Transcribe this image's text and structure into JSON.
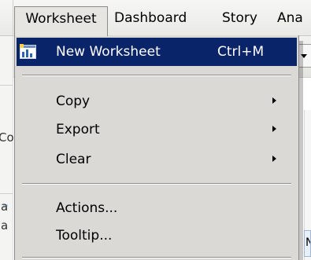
{
  "menubar": {
    "items": [
      {
        "label": "Worksheet"
      },
      {
        "label": "Dashboard"
      },
      {
        "label": "Story"
      },
      {
        "label": "Ana"
      }
    ]
  },
  "dropdown": {
    "items": [
      {
        "label": "New Worksheet",
        "shortcut": "Ctrl+M",
        "icon": "new-worksheet-icon"
      },
      {
        "label": "Copy",
        "icon": "chevron-right-icon"
      },
      {
        "label": "Export",
        "icon": "chevron-right-icon"
      },
      {
        "label": "Clear",
        "icon": "chevron-right-icon"
      },
      {
        "label": "Actions..."
      },
      {
        "label": "Tooltip..."
      }
    ]
  },
  "background": {
    "fragments": [
      "Co",
      "a",
      "a",
      "N"
    ]
  },
  "colors": {
    "highlight": "#0a246a",
    "menu_bg": "#dbd9d5",
    "menubar_bg": "#eeeeeb"
  }
}
